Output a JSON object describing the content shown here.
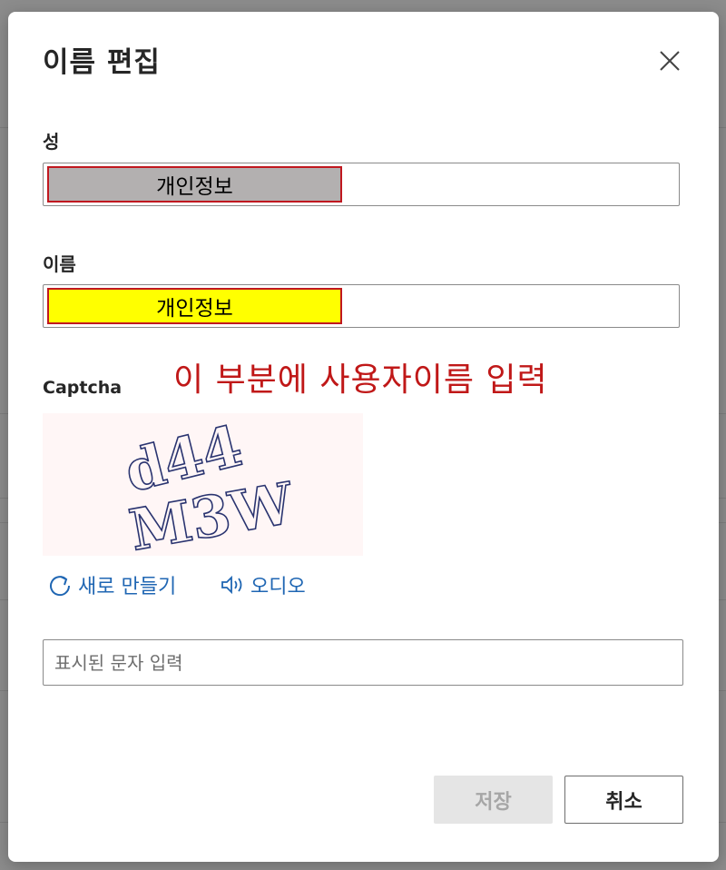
{
  "dialog": {
    "title": "이름 편집",
    "close_icon": "close-icon"
  },
  "last_name": {
    "label": "성",
    "redacted_text": "개인정보",
    "redact_color": "#b3b0b0"
  },
  "first_name": {
    "label": "이름",
    "redacted_text": "개인정보",
    "redact_color": "#ffff00"
  },
  "annotation": {
    "text": "이 부분에 사용자이름 입력",
    "color": "#c01818"
  },
  "captcha": {
    "label": "Captcha",
    "image_text": "d44M3W",
    "refresh_label": "새로 만들기",
    "refresh_icon": "refresh-icon",
    "audio_label": "오디오",
    "audio_icon": "speaker-icon",
    "input_placeholder": "표시된 문자 입력",
    "input_value": ""
  },
  "buttons": {
    "save_label": "저장",
    "cancel_label": "취소"
  },
  "colors": {
    "link": "#1f66b3",
    "border": "#8a8a8a",
    "disabled_bg": "#e5e5e5"
  }
}
